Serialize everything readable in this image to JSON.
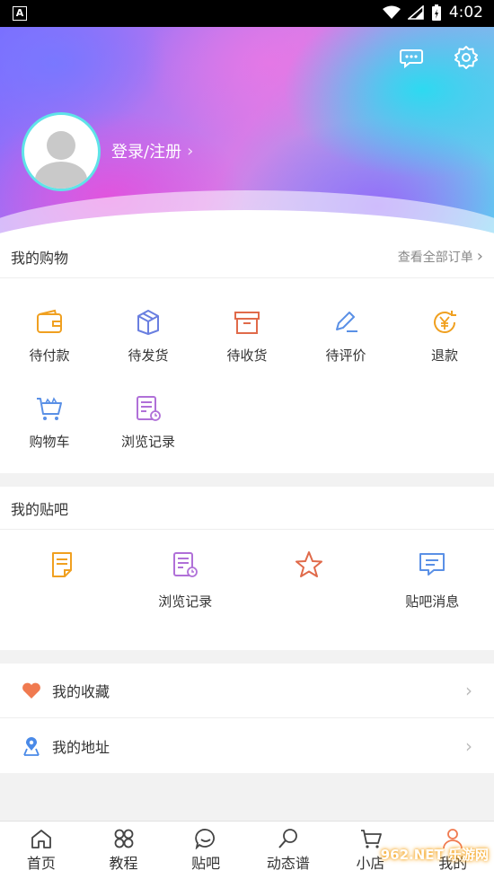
{
  "status_bar": {
    "badge": "A",
    "time": "4:02"
  },
  "profile": {
    "login_text": "登录/注册"
  },
  "shopping": {
    "title": "我的购物",
    "view_all": "查看全部订单",
    "items": [
      {
        "label": "待付款",
        "icon": "wallet-icon",
        "color": "#f0a020"
      },
      {
        "label": "待发货",
        "icon": "package-icon",
        "color": "#6a7fe0"
      },
      {
        "label": "待收货",
        "icon": "box-icon",
        "color": "#e06a4a"
      },
      {
        "label": "待评价",
        "icon": "pen-icon",
        "color": "#5a90e6"
      },
      {
        "label": "退款",
        "icon": "yen-refund-icon",
        "color": "#f0a020"
      },
      {
        "label": "购物车",
        "icon": "cart-icon",
        "color": "#5a90e6"
      },
      {
        "label": "浏览记录",
        "icon": "history-doc-icon",
        "color": "#b070d8"
      }
    ]
  },
  "tieba": {
    "title": "我的贴吧",
    "items": [
      {
        "label": "",
        "icon": "note-icon",
        "color": "#f0a020"
      },
      {
        "label": "浏览记录",
        "icon": "history-doc-icon",
        "color": "#b070d8"
      },
      {
        "label": "",
        "icon": "star-icon",
        "color": "#e06a4a"
      },
      {
        "label": "贴吧消息",
        "icon": "message-icon",
        "color": "#5a90e6"
      }
    ]
  },
  "list": [
    {
      "label": "我的收藏",
      "icon": "heart-icon",
      "color": "#f07a50"
    },
    {
      "label": "我的地址",
      "icon": "location-icon",
      "color": "#4a8ae8"
    }
  ],
  "bottom_nav": [
    {
      "label": "首页",
      "icon": "home-icon"
    },
    {
      "label": "教程",
      "icon": "grid-icon"
    },
    {
      "label": "贴吧",
      "icon": "chat-bubble-icon"
    },
    {
      "label": "动态谱",
      "icon": "search-icon"
    },
    {
      "label": "小店",
      "icon": "cart-icon"
    },
    {
      "label": "我的",
      "icon": "user-icon"
    }
  ],
  "watermark": "962.NET 乐游网"
}
